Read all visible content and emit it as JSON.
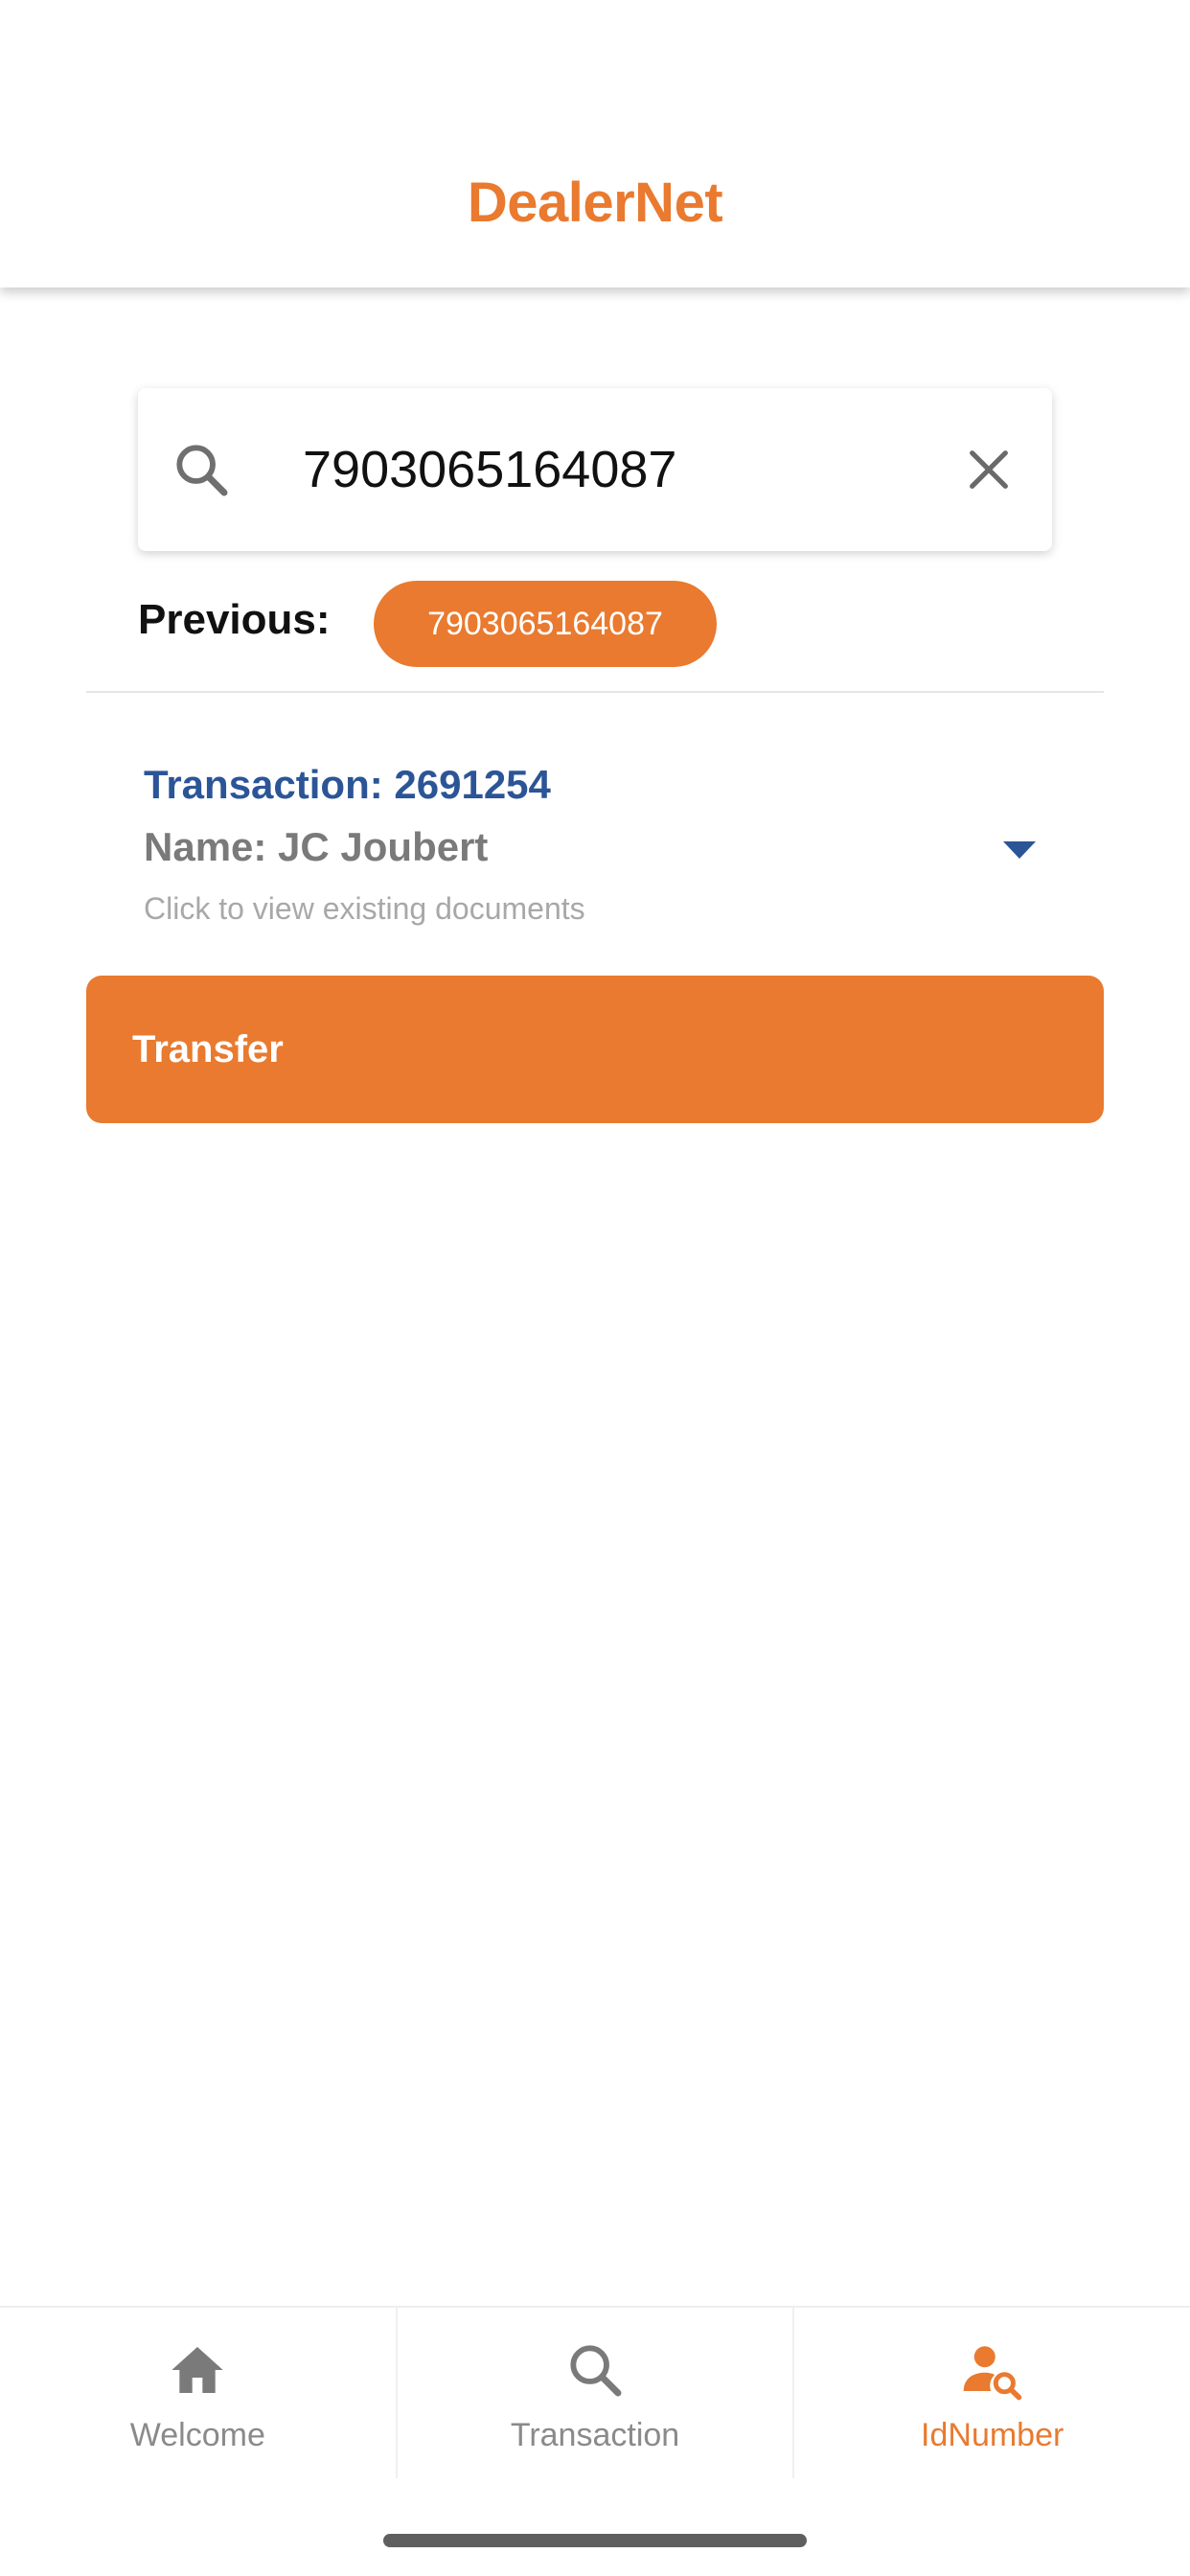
{
  "header": {
    "title": "DealerNet"
  },
  "search": {
    "value": "7903065164087",
    "icon": "search-icon",
    "clear_icon": "close-icon"
  },
  "previous": {
    "label": "Previous:",
    "chips": [
      "7903065164087"
    ]
  },
  "result": {
    "transaction": "Transaction: 2691254",
    "name": "Name: JC Joubert",
    "hint": "Click to view existing documents",
    "expand_icon": "caret-down-icon"
  },
  "transfer": {
    "label": "Transfer"
  },
  "bottom_nav": {
    "items": [
      {
        "label": "Welcome",
        "icon": "home-icon",
        "active": false
      },
      {
        "label": "Transaction",
        "icon": "search-icon",
        "active": false
      },
      {
        "label": "IdNumber",
        "icon": "person-search-icon",
        "active": true
      }
    ]
  },
  "colors": {
    "accent": "#E97A2F",
    "link_blue": "#2C5597",
    "muted": "#8a8a8a"
  }
}
